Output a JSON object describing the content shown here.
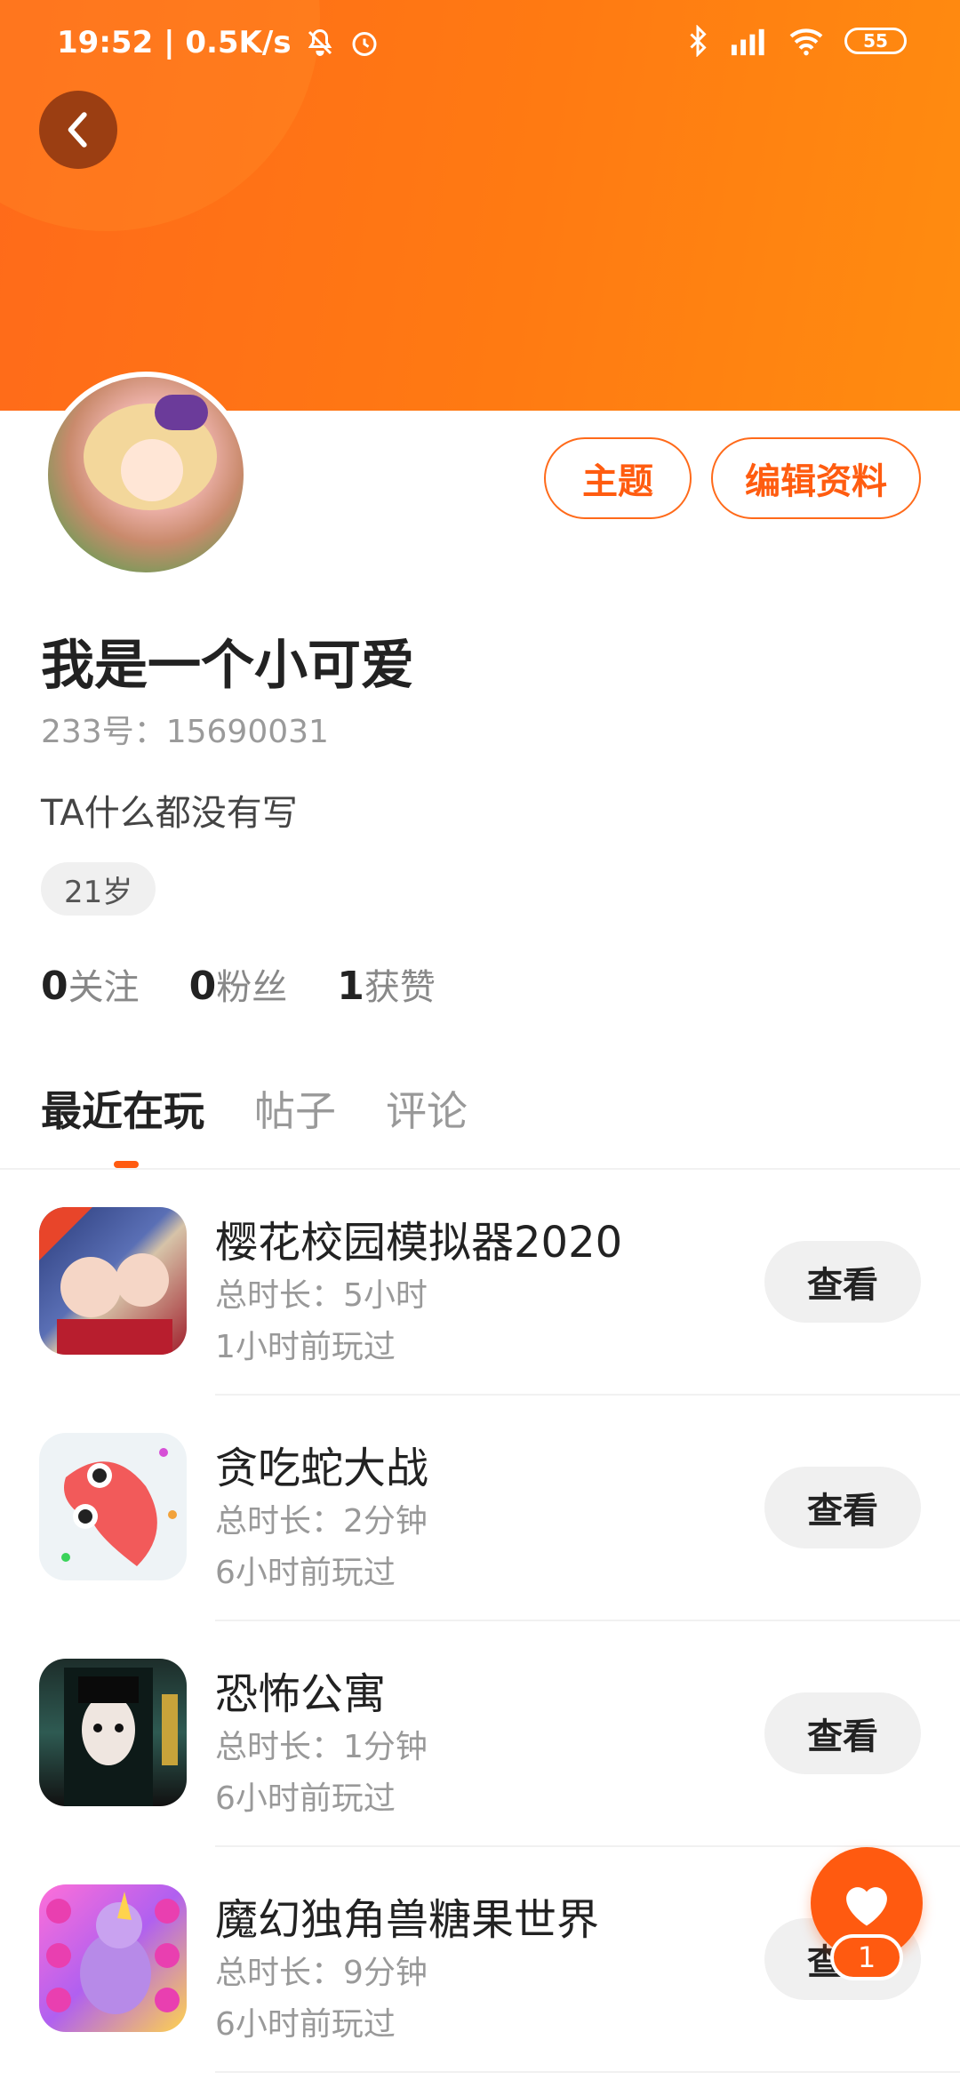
{
  "status_bar": {
    "time": "19:52 | 0.5K/s",
    "battery": "55"
  },
  "profile": {
    "theme_button": "主题",
    "edit_button": "编辑资料",
    "name": "我是一个小可爱",
    "uid": "233号：15690031",
    "bio": "TA什么都没有写",
    "age": "21岁",
    "stats": {
      "following_count": "0",
      "following_label": "关注",
      "fans_count": "0",
      "fans_label": "粉丝",
      "likes_count": "1",
      "likes_label": "获赞"
    }
  },
  "tabs": [
    "最近在玩",
    "帖子",
    "评论"
  ],
  "games": [
    {
      "title": "樱花校园模拟器2020",
      "duration": "总时长：5小时",
      "last_played": "1小时前玩过",
      "button": "查看",
      "icon": "sakura-school-icon"
    },
    {
      "title": "贪吃蛇大战",
      "duration": "总时长：2分钟",
      "last_played": "6小时前玩过",
      "button": "查看",
      "icon": "snake-battle-icon"
    },
    {
      "title": "恐怖公寓",
      "duration": "总时长：1分钟",
      "last_played": "6小时前玩过",
      "button": "查看",
      "icon": "horror-apartment-icon"
    },
    {
      "title": "魔幻独角兽糖果世界",
      "duration": "总时长：9分钟",
      "last_played": "6小时前玩过",
      "button": "查看",
      "icon": "unicorn-candy-icon"
    }
  ],
  "fab": {
    "count": "1"
  },
  "colors": {
    "accent": "#ff5a10",
    "header": "#ff7a12"
  }
}
